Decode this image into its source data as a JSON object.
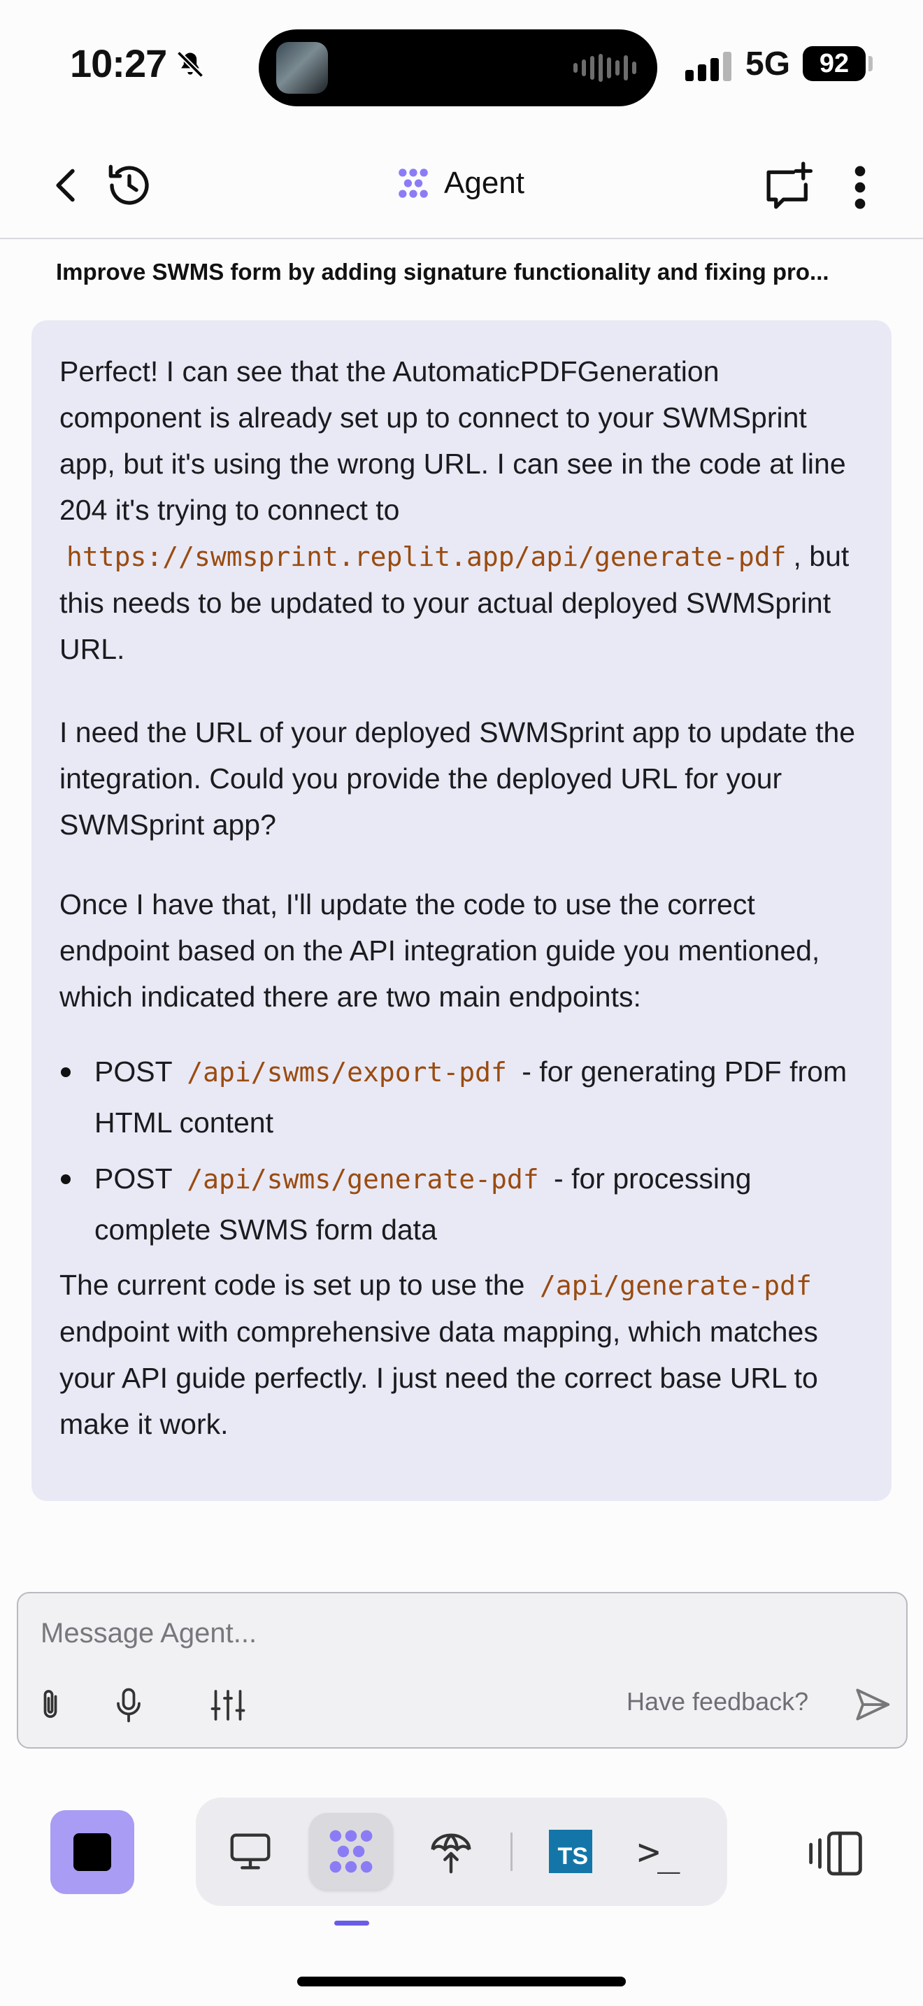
{
  "status_bar": {
    "time": "10:27",
    "network": "5G",
    "battery": "92",
    "icons": [
      "bell-slash-icon",
      "cellular-signal-icon"
    ]
  },
  "header": {
    "title": "Agent",
    "icons": [
      "chevron-left-icon",
      "history-icon",
      "agent-logo-icon",
      "new-chat-icon",
      "more-vertical-icon"
    ]
  },
  "thread": {
    "title": "Improve SWMS form by adding signature functionality and fixing pro..."
  },
  "message": {
    "p1_before": "Perfect! I can see that the AutomaticPDFGeneration component is already set up to connect to your SWMSprint app, but it's using the wrong URL. I can see in the code at line 204 it's trying to connect to",
    "p1_code": "https://swmsprint.replit.app/api/generate-pdf",
    "p1_after": ", but this needs to be updated to your actual deployed SWMSprint URL.",
    "p2": "I need the URL of your deployed SWMSprint app to update the integration. Could you provide the deployed URL for your SWMSprint app?",
    "p3": "Once I have that, I'll update the code to use the correct endpoint based on the API integration guide you mentioned, which indicated there are two main endpoints:",
    "bullets": [
      {
        "method": "POST",
        "code": "/api/swms/export-pdf",
        "text": "- for generating PDF from HTML content"
      },
      {
        "method": "POST",
        "code": "/api/swms/generate-pdf",
        "text": "- for processing complete SWMS form data"
      }
    ],
    "p4_before": "The current code is set up to use the",
    "p4_code": "/api/generate-pdf",
    "p4_after": "endpoint with comprehensive data mapping, which matches your API guide perfectly. I just need the correct base URL to make it work."
  },
  "composer": {
    "placeholder": "Message Agent...",
    "value": "",
    "feedback_label": "Have feedback?",
    "icons": [
      "paperclip-icon",
      "microphone-icon",
      "sliders-icon",
      "send-icon"
    ]
  },
  "bottom_nav": {
    "ts_label": "TS",
    "terminal_label": ">_",
    "icons": [
      "stop-icon",
      "monitor-icon",
      "agent-logo-icon",
      "deploy-icon",
      "typescript-icon",
      "terminal-icon",
      "panel-toggle-icon"
    ]
  },
  "colors": {
    "accent": "#8b7cf6",
    "bubble": "#e9e9f5",
    "code": "#9a4b10",
    "stop_button": "#a89cf5",
    "ts_badge": "#1476a8"
  }
}
